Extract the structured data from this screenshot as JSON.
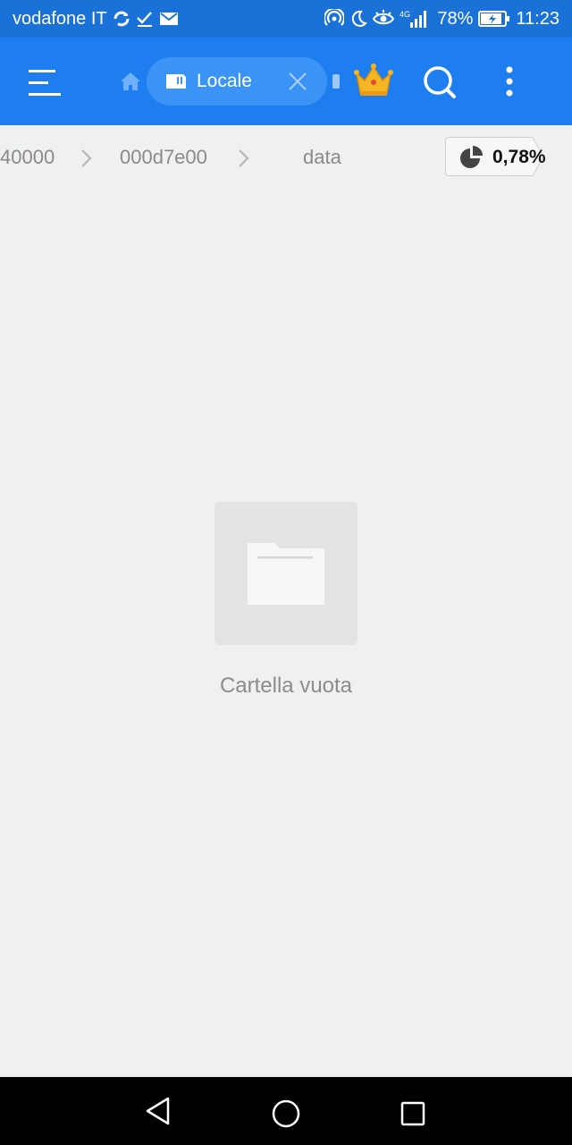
{
  "status_bar": {
    "carrier": "vodafone IT",
    "network": "4G",
    "battery": "78%",
    "time": "11:23",
    "icons_left": [
      "sync-icon",
      "check-icon",
      "mail-icon"
    ],
    "icons_right": [
      "hotspot-icon",
      "moon-icon",
      "eye-icon",
      "signal-icon",
      "battery-icon"
    ]
  },
  "app_bar": {
    "tab_label": "Locale",
    "accent": "#1e7ef0"
  },
  "breadcrumb": {
    "items": [
      "40000",
      "000d7e00",
      "data"
    ],
    "storage_percent": "0,78%"
  },
  "empty_state": {
    "message": "Cartella vuota"
  }
}
